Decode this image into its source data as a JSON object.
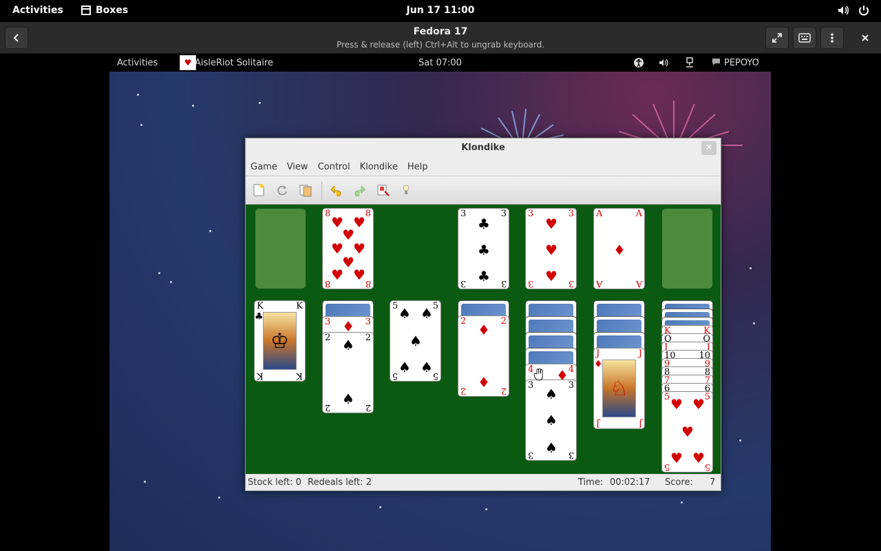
{
  "host": {
    "activities": "Activities",
    "app_name": "Boxes",
    "clock": "Jun 17  11:00"
  },
  "boxes": {
    "title": "Fedora 17",
    "subtitle": "Press & release (left) Ctrl+Alt to ungrab keyboard."
  },
  "guest": {
    "activities": "Activities",
    "app_name": "AisleRiot Solitaire",
    "clock": "Sat 07:00",
    "user": "PEPOYO"
  },
  "window": {
    "title": "Klondike",
    "menu": [
      "Game",
      "View",
      "Control",
      "Klondike",
      "Help"
    ]
  },
  "status": {
    "stock": "Stock left: 0",
    "redeals": "Redeals left: 2",
    "time_label": "Time:",
    "time_value": "00:02:17",
    "score_label": "Score:",
    "score_value": "7"
  },
  "cards": {
    "waste_8h": {
      "rank": "8",
      "suit": "♥"
    },
    "found_3c": {
      "rank": "3",
      "suit": "♣"
    },
    "found_3h": {
      "rank": "3",
      "suit": "♥"
    },
    "found_ad": {
      "rank": "A",
      "suit": "♦"
    },
    "t1_kc": {
      "rank": "K",
      "suit": "♣"
    },
    "t2_3d": {
      "rank": "3",
      "suit": "♦"
    },
    "t2_2s": {
      "rank": "2",
      "suit": "♠"
    },
    "t3_5s": {
      "rank": "5",
      "suit": "♠"
    },
    "t4_2d": {
      "rank": "2",
      "suit": "♦"
    },
    "t5_4d": {
      "rank": "4",
      "suit": "♦"
    },
    "t5_3s": {
      "rank": "3",
      "suit": "♠"
    },
    "t6_jd": {
      "rank": "J",
      "suit": "♦"
    },
    "t7_k": {
      "rank": "K"
    },
    "t7_q": {
      "rank": "Q"
    },
    "t7_j": {
      "rank": "J"
    },
    "t7_10": {
      "rank": "10"
    },
    "t7_9": {
      "rank": "9"
    },
    "t7_8": {
      "rank": "8"
    },
    "t7_7": {
      "rank": "7"
    },
    "t7_6": {
      "rank": "6"
    },
    "t7_5h": {
      "rank": "5",
      "suit": "♥"
    }
  }
}
